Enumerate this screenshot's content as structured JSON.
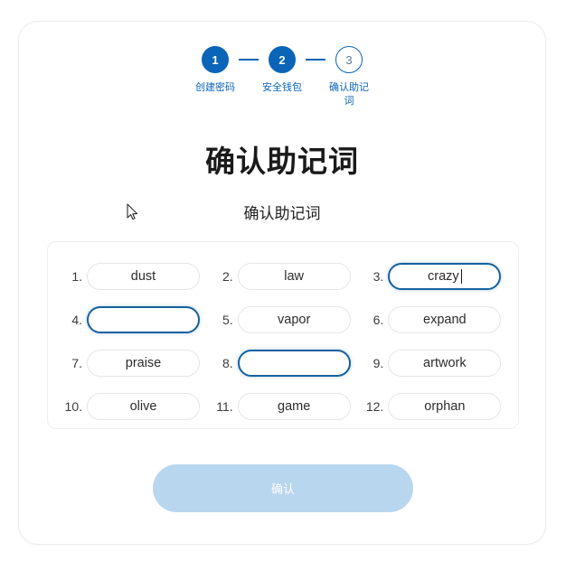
{
  "stepper": {
    "steps": [
      {
        "number": "1",
        "label": "创建密码",
        "state": "done"
      },
      {
        "number": "2",
        "label": "安全钱包",
        "state": "done"
      },
      {
        "number": "3",
        "label": "确认助记词",
        "state": "todo"
      }
    ],
    "accent_color": "#0a64b8"
  },
  "page": {
    "title": "确认助记词",
    "subtitle": "确认助记词"
  },
  "mnemonic": {
    "words": [
      {
        "index": "1.",
        "value": "dust",
        "state": "filled"
      },
      {
        "index": "2.",
        "value": "law",
        "state": "filled"
      },
      {
        "index": "3.",
        "value": "crazy",
        "state": "focused-filled"
      },
      {
        "index": "4.",
        "value": "",
        "state": "focused-empty"
      },
      {
        "index": "5.",
        "value": "vapor",
        "state": "filled"
      },
      {
        "index": "6.",
        "value": "expand",
        "state": "filled"
      },
      {
        "index": "7.",
        "value": "praise",
        "state": "filled"
      },
      {
        "index": "8.",
        "value": "",
        "state": "focused-empty"
      },
      {
        "index": "9.",
        "value": "artwork",
        "state": "filled"
      },
      {
        "index": "10.",
        "value": "olive",
        "state": "filled"
      },
      {
        "index": "11.",
        "value": "game",
        "state": "filled"
      },
      {
        "index": "12.",
        "value": "orphan",
        "state": "filled"
      }
    ],
    "focused_border_color": "#16619f",
    "idle_border_color": "#e6e6e6"
  },
  "actions": {
    "confirm_label": "确认",
    "confirm_disabled_color": "#b9d6ef"
  }
}
